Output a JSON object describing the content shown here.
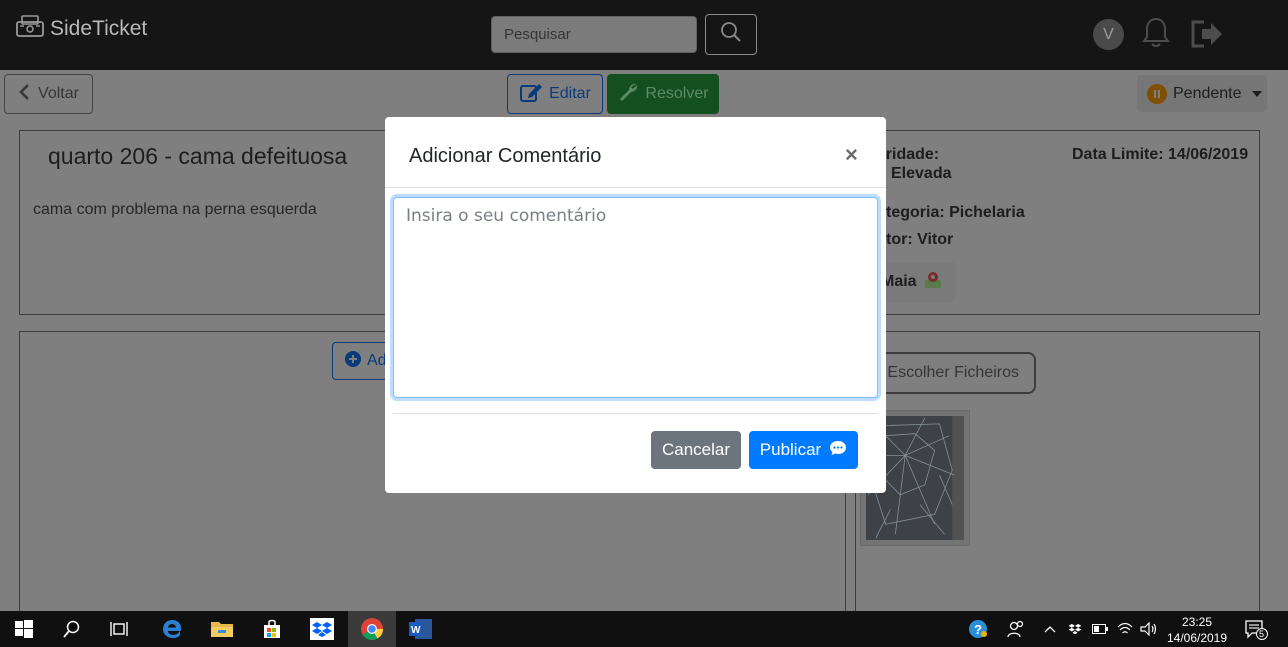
{
  "app": {
    "name": "SideTicket"
  },
  "header": {
    "search_placeholder": "Pesquisar",
    "user_initial": "V"
  },
  "toolbar": {
    "back_label": "Voltar",
    "edit_label": "Editar",
    "resolve_label": "Resolver",
    "status_label": "Pendente"
  },
  "ticket": {
    "title": "quarto 206 - cama defeituosa",
    "description": "cama com problema na perna esquerda",
    "priority_label": "oridade:",
    "priority_value": "Elevada",
    "due_date": "Data Limite: 14/06/2019",
    "category": "tegoria: Pichelaria",
    "author": "tor: Vitor",
    "location": "Maia"
  },
  "comments": {
    "add_label_partial": "Ad"
  },
  "files": {
    "choose_label": "Escolher Ficheiros"
  },
  "modal": {
    "title": "Adicionar Comentário",
    "close_symbol": "×",
    "placeholder": "Insira o seu comentário",
    "cancel_label": "Cancelar",
    "publish_label": "Publicar"
  },
  "taskbar": {
    "time": "23:25",
    "date": "14/06/2019",
    "notification_count": "5"
  },
  "colors": {
    "overlay_bg": "#7f7f7f",
    "primary": "#007bff",
    "secondary": "#6c757d",
    "success_dim": "#14501f",
    "warning_dim": "#7f5004",
    "navbar": "#151515"
  }
}
